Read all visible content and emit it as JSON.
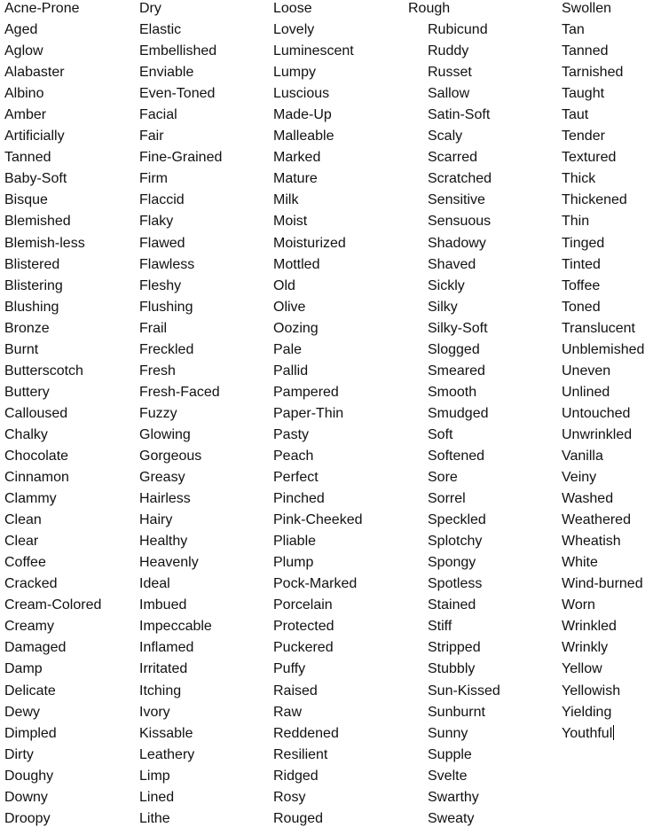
{
  "columns": [
    [
      "Acne-Prone",
      "Aged",
      "Aglow",
      "Alabaster",
      "Albino",
      "Amber",
      "Artificially Tanned",
      "Baby-Soft",
      "Bisque",
      "Blemished",
      "Blemish-less",
      "Blistered",
      "Blistering",
      "Blushing",
      "Bronze",
      "Burnt",
      "Butterscotch",
      "Buttery",
      "Calloused",
      "Chalky",
      "Chocolate",
      "Cinnamon",
      "Clammy",
      "Clean",
      "Clear",
      "Coffee",
      "Cracked",
      "Cream-Colored",
      "Creamy",
      "Damaged",
      "Damp",
      "Delicate",
      "Dewy",
      "Dimpled",
      "Dirty",
      "Doughy",
      "Downy",
      "Droopy"
    ],
    [
      "Dry",
      "Elastic",
      "Embellished",
      "Enviable",
      "Even-Toned",
      "Facial",
      "Fair",
      "Fine-Grained",
      "Firm",
      "Flaccid",
      "Flaky",
      "Flawed",
      "Flawless",
      "Fleshy",
      "Flushing",
      "Frail",
      "Freckled",
      "Fresh",
      "Fresh-Faced",
      "Fuzzy",
      "Glowing",
      "Gorgeous",
      "Greasy",
      "Hairless",
      "Hairy",
      "Healthy",
      "Heavenly",
      "Ideal",
      "Imbued",
      "Impeccable",
      "Inflamed",
      "Irritated",
      "Itching",
      "Ivory",
      "Kissable",
      "Leathery",
      "Limp",
      "Lined",
      "Lithe"
    ],
    [
      "Loose",
      "Lovely",
      "Luminescent",
      "Lumpy",
      "Luscious",
      "Made-Up",
      "Malleable",
      "Marked",
      "Mature",
      "Milk",
      "Moist",
      "Moisturized",
      "Mottled",
      "Old",
      "Olive",
      "Oozing",
      "Pale",
      "Pallid",
      "Pampered",
      "Paper-Thin",
      "Pasty",
      "Peach",
      "Perfect",
      "Pinched",
      "Pink-Cheeked",
      "Pliable",
      "Plump",
      "Pock-Marked",
      "Porcelain",
      "Protected",
      "Puckered",
      "Puffy",
      "Raised",
      "Raw",
      "Reddened",
      "Resilient",
      "Ridged",
      "Rosy",
      "Rouged"
    ],
    [
      "Rough",
      "Rubicund",
      "Ruddy",
      "Russet",
      "Sallow",
      "Satin-Soft",
      "Scaly",
      "Scarred",
      "Scratched",
      "Sensitive",
      "Sensuous",
      "Shadowy",
      "Shaved",
      "Sickly",
      "Silky",
      "Silky-Soft",
      "Slogged",
      "Smeared",
      "Smooth",
      "Smudged",
      "Soft",
      "Softened",
      "Sore",
      "Sorrel",
      "Speckled",
      "Splotchy",
      "Spongy",
      "Spotless",
      "Stained",
      "Stiff",
      "Stripped",
      "Stubbly",
      "Sun-Kissed",
      "Sunburnt",
      "Sunny",
      "Supple",
      "Svelte",
      "Swarthy",
      "Sweaty"
    ],
    [
      "Swollen",
      "Tan",
      "Tanned",
      "Tarnished",
      "Taught",
      "Taut",
      "Tender",
      "Textured",
      "Thick",
      "Thickened",
      "Thin",
      "Tinged",
      "Tinted",
      "Toffee",
      "Toned",
      "Translucent",
      "Unblemished",
      "Uneven",
      "Unlined",
      "Untouched",
      "Unwrinkled",
      "Vanilla",
      "Veiny",
      "Washed",
      "Weathered",
      "Wheatish",
      "White",
      "Wind-burned",
      "Worn",
      "Wrinkled",
      "Wrinkly",
      "Yellow",
      "Yellowish",
      "Yielding",
      "Youthful"
    ]
  ]
}
